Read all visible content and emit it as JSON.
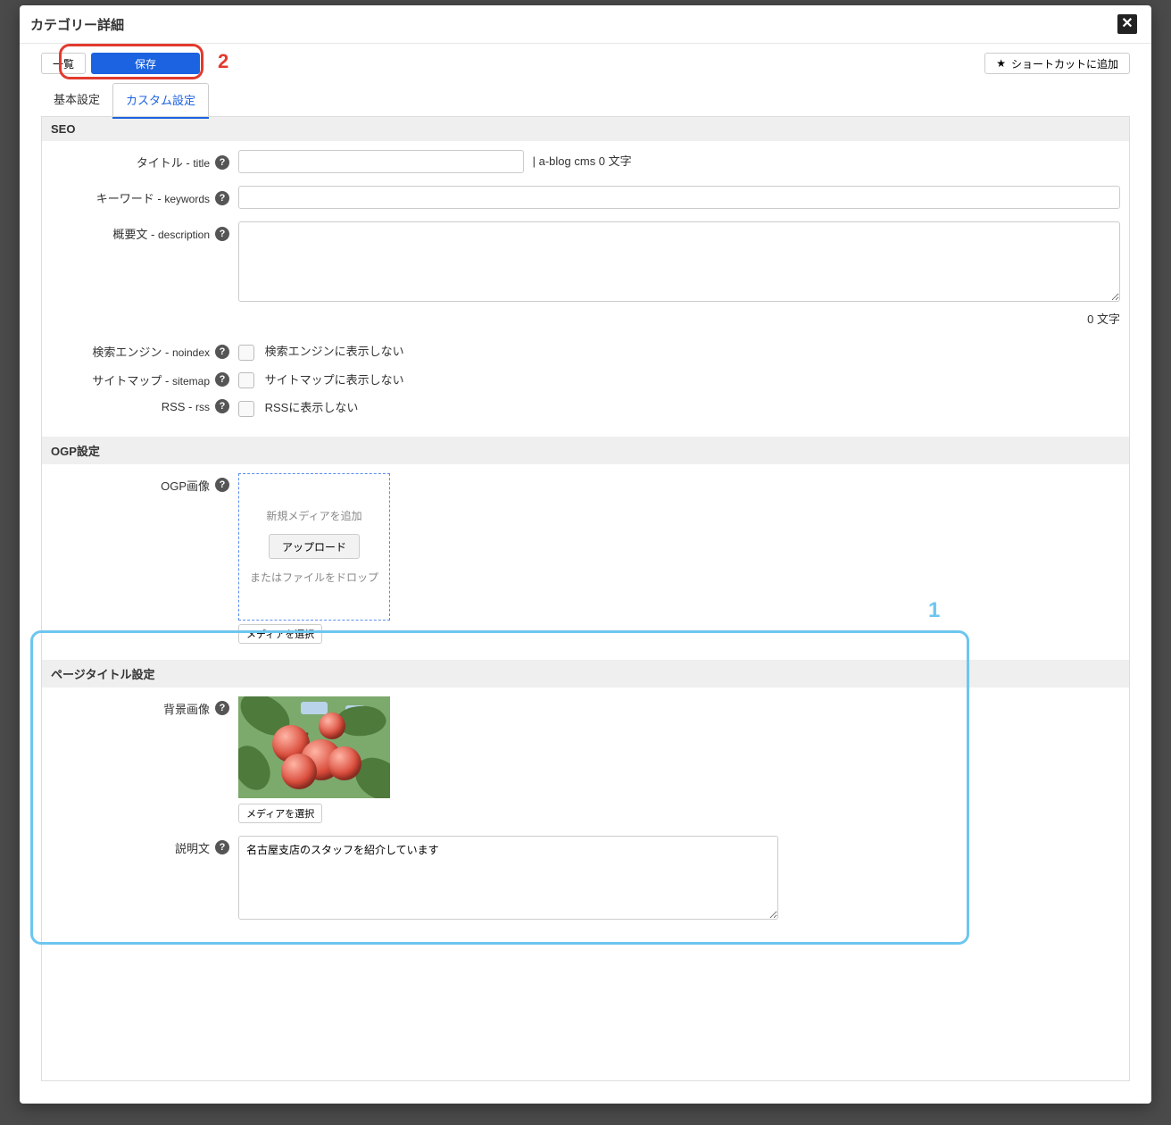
{
  "modal": {
    "title": "カテゴリー詳細"
  },
  "toolbar": {
    "list_label": "一覧",
    "save_label": "保存",
    "shortcut_label": "ショートカットに追加"
  },
  "tabs": {
    "basic": "基本設定",
    "custom": "カスタム設定"
  },
  "annotations": {
    "mark1": "1",
    "mark2": "2"
  },
  "seo": {
    "heading": "SEO",
    "title_label_main": "タイトル -",
    "title_label_sub": "title",
    "title_value": "",
    "title_suffix": "| a-blog cms 0 文字",
    "keywords_label_main": "キーワード -",
    "keywords_label_sub": "keywords",
    "keywords_value": "",
    "description_label_main": "概要文 -",
    "description_label_sub": "description",
    "description_value": "",
    "description_counter": "0 文字",
    "noindex_label_main": "検索エンジン -",
    "noindex_label_sub": "noindex",
    "noindex_option": "検索エンジンに表示しない",
    "sitemap_label_main": "サイトマップ -",
    "sitemap_label_sub": "sitemap",
    "sitemap_option": "サイトマップに表示しない",
    "rss_label_main": "RSS -",
    "rss_label_sub": "rss",
    "rss_option": "RSSに表示しない"
  },
  "ogp": {
    "heading": "OGP設定",
    "image_label": "OGP画像",
    "drop_add": "新規メディアを追加",
    "upload_btn": "アップロード",
    "drop_or": "またはファイルをドロップ",
    "select_media": "メディアを選択"
  },
  "page_title": {
    "heading": "ページタイトル設定",
    "bg_label": "背景画像",
    "select_media": "メディアを選択",
    "desc_label": "説明文",
    "desc_value": "名古屋支店のスタッフを紹介しています"
  }
}
